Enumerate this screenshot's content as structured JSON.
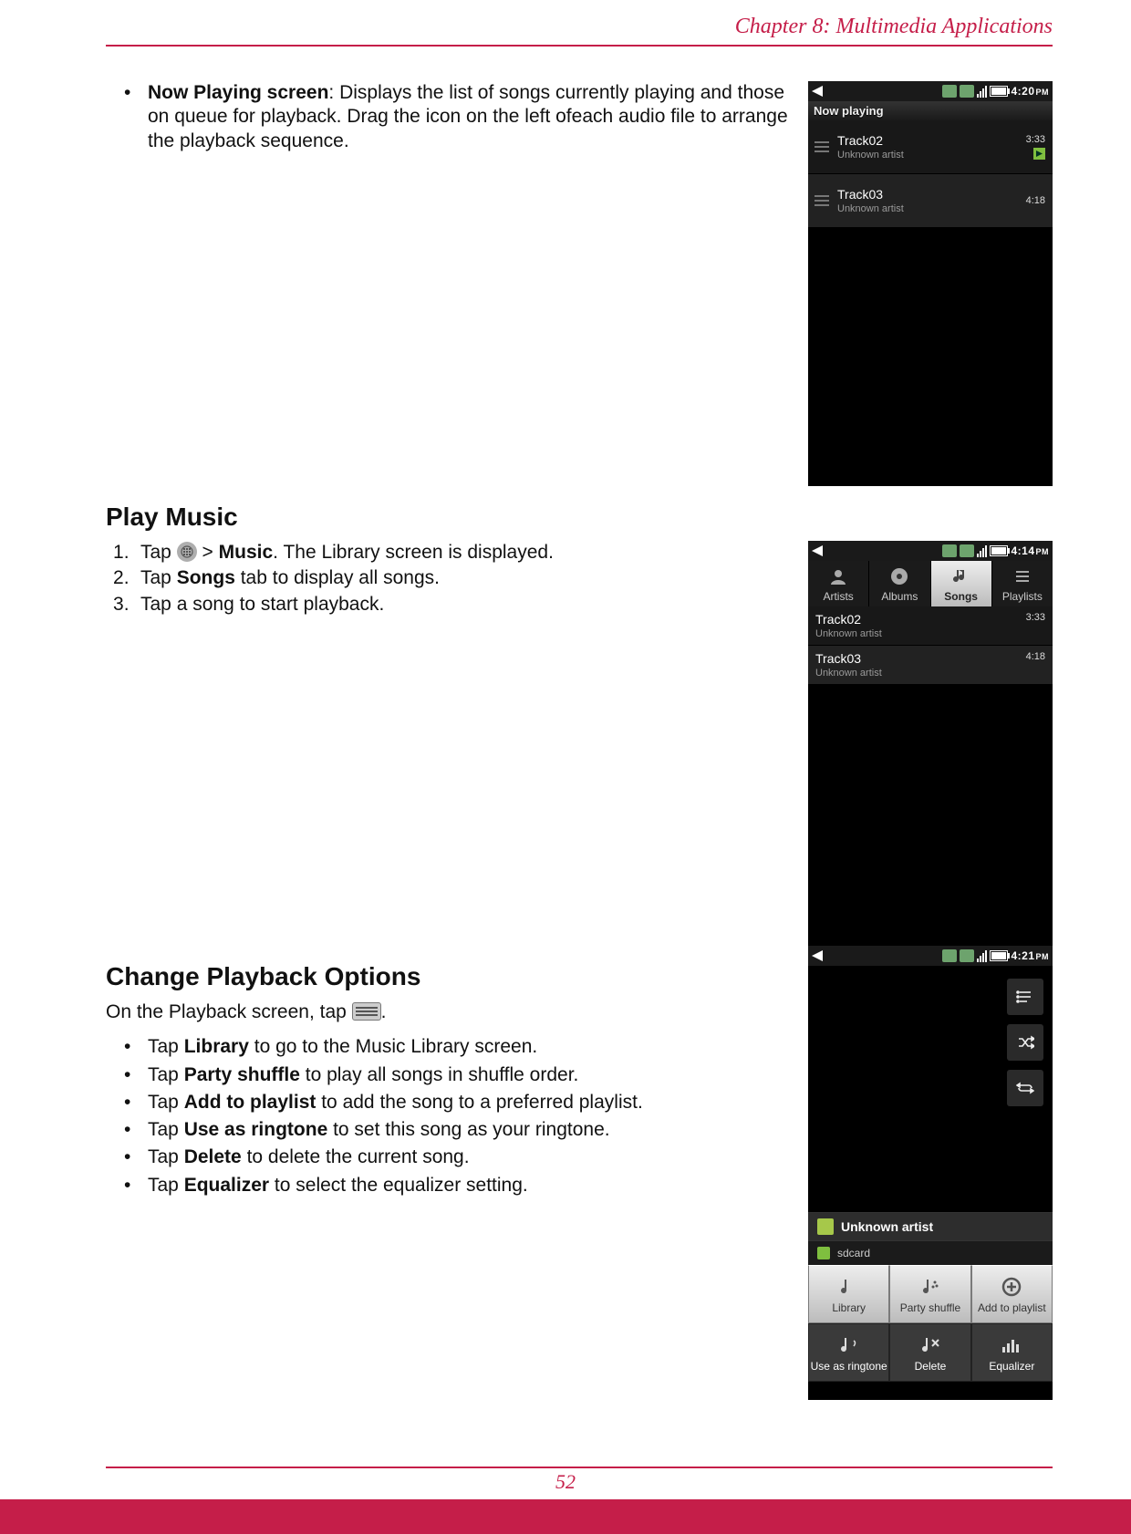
{
  "header": {
    "chapter_label": "Chapter 8: Multimedia Applications"
  },
  "section1": {
    "bullet_lead": "Now Playing screen",
    "bullet_rest": ": Displays the list of songs currently playing and those on queue for playback. Drag the icon on the left ofeach audio file to arrange the playback sequence."
  },
  "section2": {
    "heading": "Play Music",
    "step1_pre": "Tap ",
    "step1_mid": " > ",
    "step1_bold": "Music",
    "step1_post": ". The Library screen is displayed.",
    "step2_pre": "Tap ",
    "step2_bold": "Songs",
    "step2_post": " tab to display all songs.",
    "step3": "Tap a song to start playback."
  },
  "section3": {
    "heading": "Change Playback Options",
    "intro_pre": "On the Playback screen, tap ",
    "intro_post": ".",
    "items": [
      {
        "pre": "Tap ",
        "bold": "Library",
        "post": " to go to the Music Library screen."
      },
      {
        "pre": "Tap ",
        "bold": "Party shuffle",
        "post": " to play all songs in shuffle order."
      },
      {
        "pre": "Tap ",
        "bold": "Add to playlist",
        "post": " to add the song to a preferred playlist."
      },
      {
        "pre": "Tap ",
        "bold": "Use as ringtone",
        "post": " to set this song as your ringtone."
      },
      {
        "pre": "Tap ",
        "bold": "Delete",
        "post": " to delete the current song."
      },
      {
        "pre": "Tap ",
        "bold": "Equalizer",
        "post": " to select the equalizer setting."
      }
    ]
  },
  "phone1": {
    "clock": "4:20",
    "ampm": "PM",
    "title": "Now playing",
    "tracks": [
      {
        "name": "Track02",
        "artist": "Unknown artist",
        "time": "3:33",
        "playing": true
      },
      {
        "name": "Track03",
        "artist": "Unknown artist",
        "time": "4:18",
        "playing": false
      }
    ]
  },
  "phone2": {
    "clock": "4:14",
    "ampm": "PM",
    "tabs": [
      "Artists",
      "Albums",
      "Songs",
      "Playlists"
    ],
    "active_tab_index": 2,
    "songs": [
      {
        "name": "Track02",
        "artist": "Unknown artist",
        "time": "3:33"
      },
      {
        "name": "Track03",
        "artist": "Unknown artist",
        "time": "4:18"
      }
    ]
  },
  "phone3": {
    "clock": "4:21",
    "ampm": "PM",
    "artist_label": "Unknown artist",
    "sd_label": "sdcard",
    "menu_top": [
      "Library",
      "Party shuffle",
      "Add to playlist"
    ],
    "menu_bottom": [
      "Use as ringtone",
      "Delete",
      "Equalizer"
    ]
  },
  "footer": {
    "page_number": "52"
  }
}
